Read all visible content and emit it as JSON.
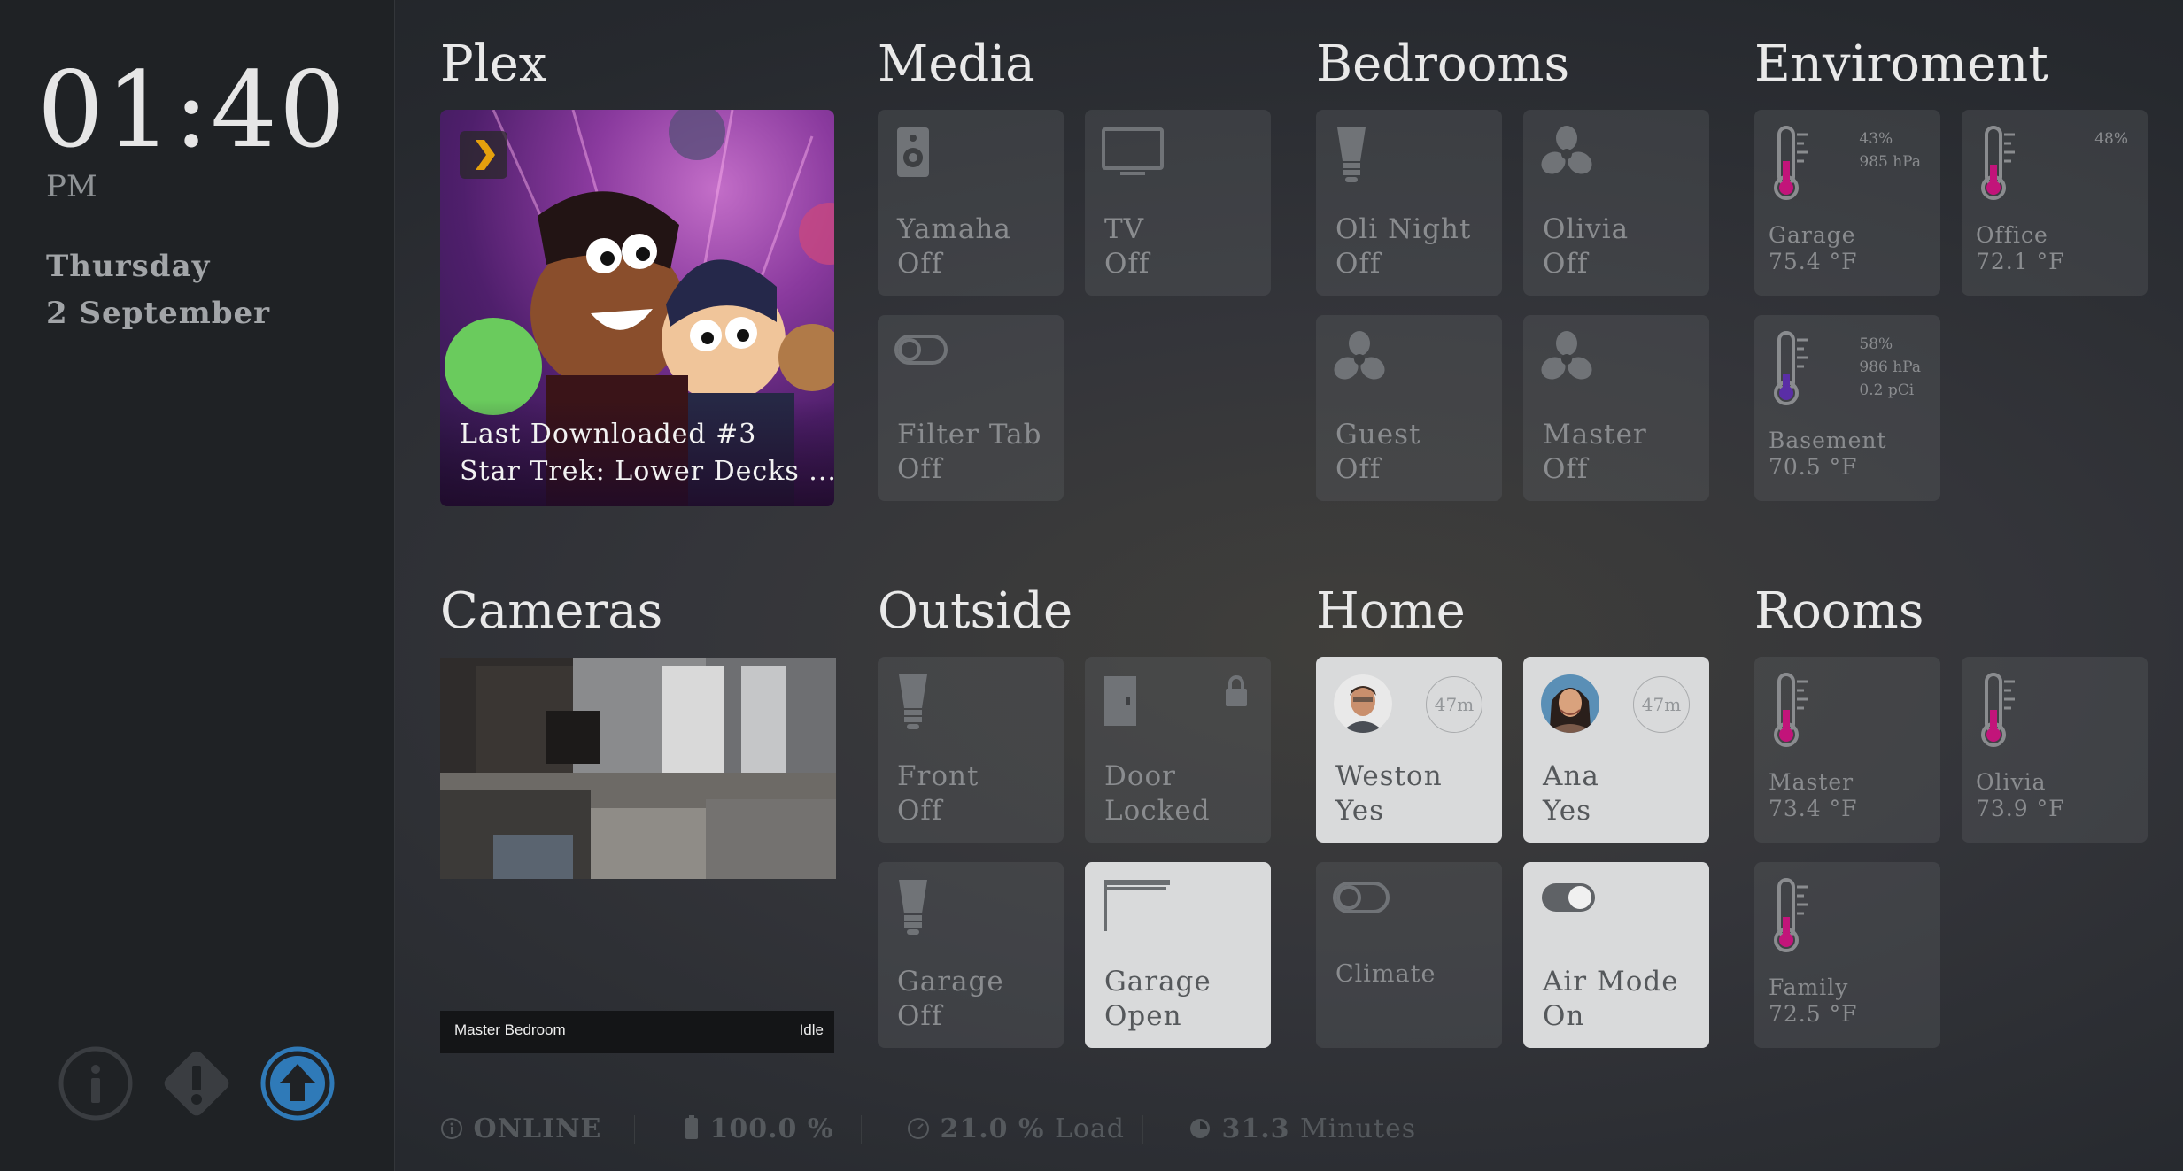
{
  "sidebar": {
    "time": "01:40",
    "ampm": "PM",
    "weekday": "Thursday",
    "date": "2 September",
    "buttons": [
      {
        "icon": "info-icon"
      },
      {
        "icon": "alert-diamond-icon"
      },
      {
        "icon": "upload-arrow-icon",
        "color": "#2f7ab8"
      }
    ]
  },
  "sections": {
    "plex": "Plex",
    "media": "Media",
    "bedrooms": "Bedrooms",
    "environment": "Enviroment",
    "cameras": "Cameras",
    "outside": "Outside",
    "home": "Home",
    "rooms": "Rooms"
  },
  "plex": {
    "line1": "Last Downloaded #3",
    "line2": "Star Trek: Lower Decks ..."
  },
  "media": [
    {
      "name": "Yamaha",
      "state": "Off",
      "icon": "speaker-icon"
    },
    {
      "name": "TV",
      "state": "Off",
      "icon": "tv-icon"
    },
    {
      "name": "Filter Tab",
      "state": "Off",
      "icon": "toggle-off-icon"
    }
  ],
  "bedrooms": [
    {
      "name": "Oli Night",
      "state": "Off",
      "icon": "bulb-icon"
    },
    {
      "name": "Olivia",
      "state": "Off",
      "icon": "fan-icon"
    },
    {
      "name": "Guest",
      "state": "Off",
      "icon": "fan-icon"
    },
    {
      "name": "Master",
      "state": "Off",
      "icon": "fan-icon"
    }
  ],
  "environment": [
    {
      "name": "Garage",
      "value": "75.4 °F",
      "humidity": "43%",
      "pressure": "985 hPa"
    },
    {
      "name": "Office",
      "value": "72.1 °F",
      "humidity": "48%"
    },
    {
      "name": "Basement",
      "value": "70.5 °F",
      "humidity": "58%",
      "pressure": "986 hPa",
      "radon": "0.2 pCi"
    }
  ],
  "camera": {
    "name": "Master Bedroom",
    "status": "Idle"
  },
  "outside": [
    {
      "name": "Front",
      "state": "Off",
      "icon": "bulb-icon"
    },
    {
      "name": "Door",
      "state": "Locked",
      "icon": "door-icon",
      "extra_icon": "lock-icon"
    },
    {
      "name": "Garage",
      "state": "Off",
      "icon": "bulb-icon"
    },
    {
      "name": "Garage",
      "state": "Open",
      "icon": "garage-door-icon",
      "active": true
    }
  ],
  "home": [
    {
      "name": "Weston",
      "state": "Yes",
      "badge": "47m",
      "active": true
    },
    {
      "name": "Ana",
      "state": "Yes",
      "badge": "47m",
      "active": true
    },
    {
      "name": "Climate",
      "state": "",
      "icon": "toggle-off-icon"
    },
    {
      "name": "Air Mode",
      "state": "On",
      "icon": "toggle-on-icon",
      "active": true
    }
  ],
  "rooms": [
    {
      "name": "Master",
      "value": "73.4 °F"
    },
    {
      "name": "Olivia",
      "value": "73.9 °F"
    },
    {
      "name": "Family",
      "value": "72.5 °F"
    }
  ],
  "status_bar": {
    "online": "ONLINE",
    "battery": "100.0 %",
    "load_value": "21.0 %",
    "load_label": "Load",
    "runtime_value": "31.3",
    "runtime_label": "Minutes"
  },
  "colors": {
    "thermometer_fill": "#c2147a",
    "tile_bg": "#4a4c4f",
    "tile_active": "#d9dadb",
    "accent": "#2f7ab8"
  }
}
